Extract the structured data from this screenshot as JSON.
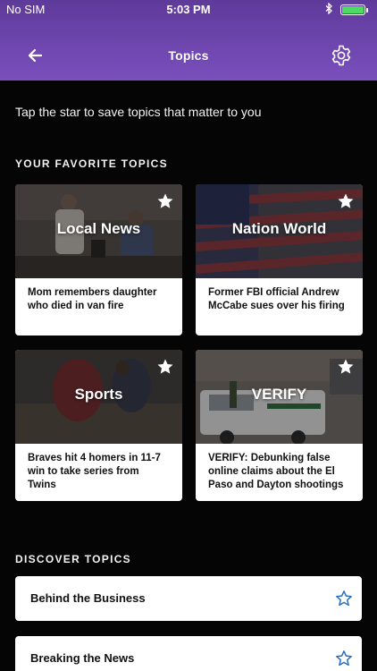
{
  "status_bar": {
    "carrier": "No SIM",
    "time": "5:03 PM",
    "bluetooth_icon": "bluetooth-icon",
    "battery_icon": "battery-icon"
  },
  "header": {
    "title": "Topics",
    "back_icon": "back-arrow-icon",
    "settings_icon": "gear-icon",
    "accent": "#6b44aa"
  },
  "intro": "Tap the star to save topics that matter to you",
  "favorites": {
    "title": "YOUR FAVORITE TOPICS",
    "items": [
      {
        "label": "Local News",
        "headline": "Mom remembers daughter who died in van fire",
        "starred": true
      },
      {
        "label": "Nation World",
        "headline": "Former FBI official Andrew McCabe sues over his firing",
        "starred": true
      },
      {
        "label": "Sports",
        "headline": "Braves hit 4 homers in 11-7 win to take series from Twins",
        "starred": true
      },
      {
        "label": "VERIFY",
        "headline": "VERIFY: Debunking false online claims about the El Paso and Dayton shootings",
        "starred": true
      }
    ]
  },
  "discover": {
    "title": "DISCOVER TOPICS",
    "items": [
      {
        "label": "Behind the Business",
        "starred": false
      },
      {
        "label": "Breaking the News",
        "starred": false
      }
    ],
    "star_color": "#2b6fbf"
  }
}
